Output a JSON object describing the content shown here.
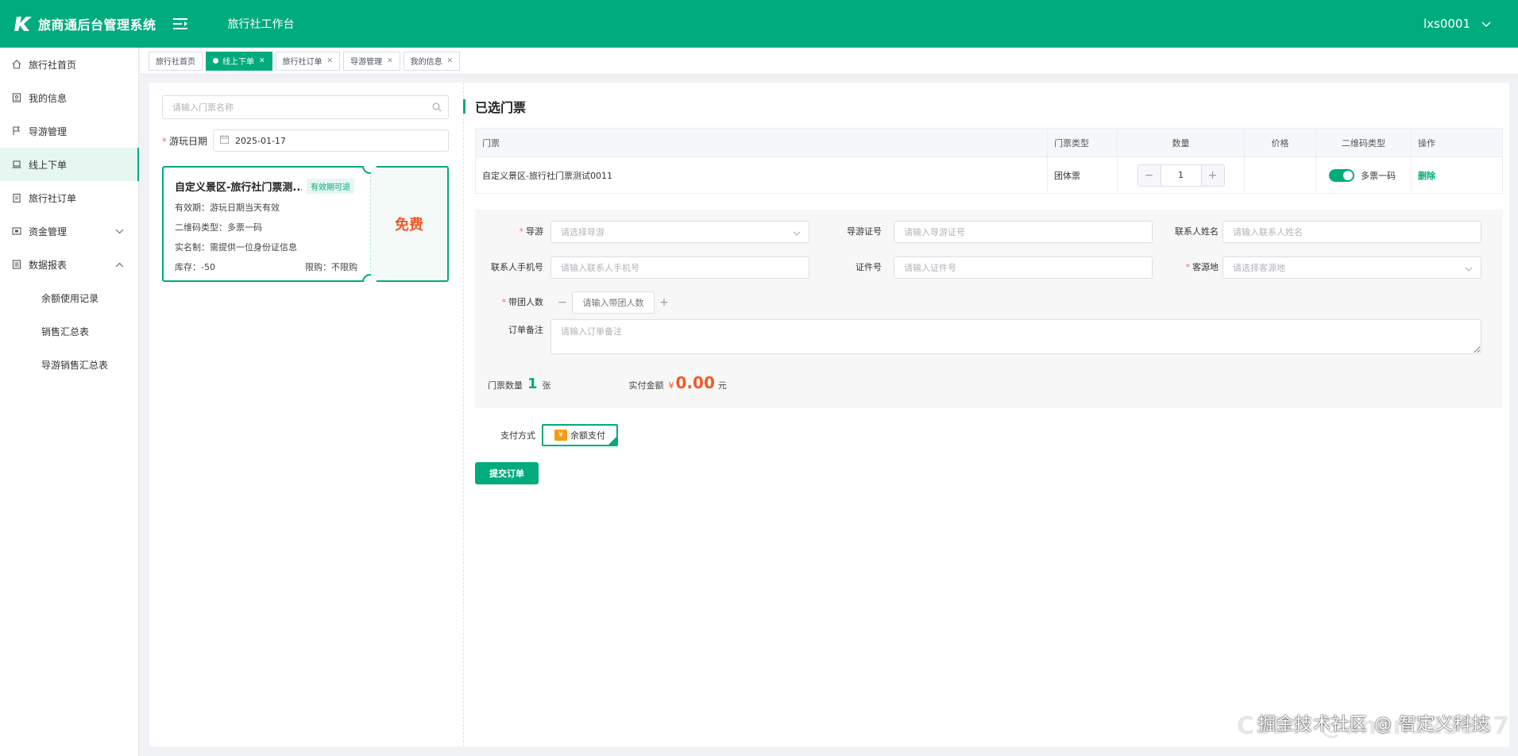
{
  "header": {
    "app_title": "旅商通后台管理系统",
    "workspace_title": "旅行社工作台",
    "user": "lxs0001"
  },
  "sidebar": {
    "items": [
      {
        "label": "旅行社首页",
        "icon": "home-icon"
      },
      {
        "label": "我的信息",
        "icon": "profile-icon"
      },
      {
        "label": "导游管理",
        "icon": "flag-icon"
      },
      {
        "label": "线上下单",
        "icon": "laptop-icon",
        "active": true
      },
      {
        "label": "旅行社订单",
        "icon": "clipboard-icon"
      },
      {
        "label": "资金管理",
        "icon": "wallet-icon",
        "expandable": true
      },
      {
        "label": "数据报表",
        "icon": "report-icon",
        "expanded": true
      }
    ],
    "sub_items": [
      "余额使用记录",
      "销售汇总表",
      "导游销售汇总表"
    ]
  },
  "tabs": [
    {
      "label": "旅行社首页"
    },
    {
      "label": "线上下单",
      "active": true
    },
    {
      "label": "旅行社订单"
    },
    {
      "label": "导游管理"
    },
    {
      "label": "我的信息"
    }
  ],
  "left": {
    "search_placeholder": "请输入门票名称",
    "date_label": "游玩日期",
    "date_value": "2025-01-17",
    "ticket": {
      "name": "自定义景区-旅行社门票测...",
      "badge": "有效期可退",
      "validity": "有效期：游玩日期当天有效",
      "qr_type": "二维码类型：多票一码",
      "real_name": "实名制：需提供一位身份证信息",
      "stock": "库存：-50",
      "limit": "限购：不限购",
      "price_label": "免费"
    }
  },
  "selected": {
    "title": "已选门票",
    "columns": [
      "门票",
      "门票类型",
      "数量",
      "价格",
      "二维码类型",
      "操作"
    ],
    "row": {
      "ticket": "自定义景区-旅行社门票测试0011",
      "type": "团体票",
      "quantity": "1",
      "price": "",
      "qr_type": "多票一码",
      "action": "删除"
    }
  },
  "form": {
    "guide_label": "导游",
    "guide_placeholder": "请选择导游",
    "guide_cert_label": "导游证号",
    "guide_cert_placeholder": "请输入导游证号",
    "contact_name_label": "联系人姓名",
    "contact_name_placeholder": "请输入联系人姓名",
    "contact_phone_label": "联系人手机号",
    "contact_phone_placeholder": "请输入联系人手机号",
    "id_label": "证件号",
    "id_placeholder": "请输入证件号",
    "source_label": "客源地",
    "source_placeholder": "请选择客源地",
    "group_label": "带团人数",
    "group_placeholder": "请输入带团人数",
    "remark_label": "订单备注",
    "remark_placeholder": "请输入订单备注",
    "ticket_count_label": "门票数量",
    "ticket_count": "1",
    "ticket_unit": "张",
    "amount_label": "实付金额",
    "currency": "¥",
    "amount": "0.00",
    "amount_unit": "元"
  },
  "payment": {
    "label": "支付方式",
    "option": "余额支付",
    "option_icon": "¥"
  },
  "submit_label": "提交订单",
  "watermark": "掘金技术社区 @ 智定义科技",
  "watermark_ghost": "CSDN @anan123867",
  "colors": {
    "primary": "#00ab7d",
    "price": "#f05a28"
  }
}
